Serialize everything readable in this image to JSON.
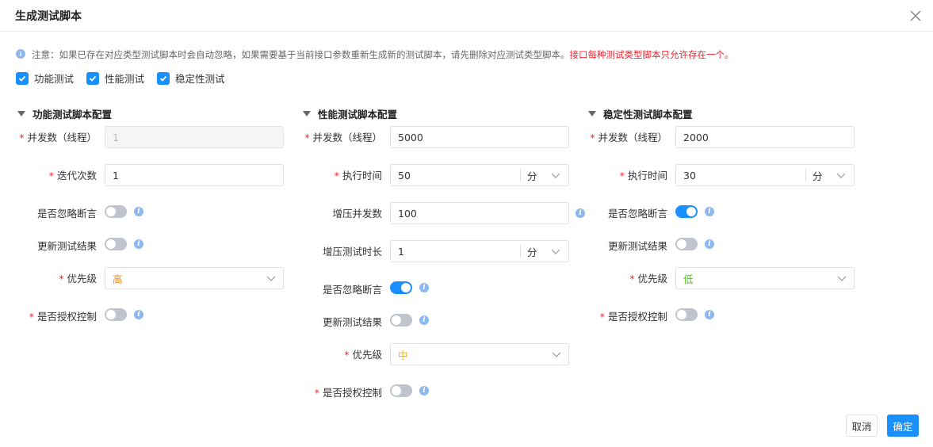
{
  "dialog": {
    "title": "生成测试脚本",
    "notice": "注意：如果已存在对应类型测试脚本时会自动忽略，如果需要基于当前接口参数重新生成新的测试脚本，请先删除对应测试类型脚本。",
    "notice_warning": "接口每种测试类型脚本只允许存在一个。",
    "checkboxes": [
      {
        "label": "功能测试",
        "checked": true
      },
      {
        "label": "性能测试",
        "checked": true
      },
      {
        "label": "稳定性测试",
        "checked": true
      }
    ],
    "cancel_label": "取消",
    "ok_label": "确定"
  },
  "func": {
    "title": "功能测试脚本配置",
    "concurrency_label": "并发数（线程）",
    "concurrency_value": "1",
    "iterations_label": "迭代次数",
    "iterations_value": "1",
    "ignore_assert_label": "是否忽略断言",
    "ignore_assert_on": false,
    "update_result_label": "更新测试结果",
    "update_result_on": false,
    "priority_label": "优先级",
    "priority_value": "高",
    "auth_label": "是否授权控制",
    "auth_on": false
  },
  "perf": {
    "title": "性能测试脚本配置",
    "concurrency_label": "并发数（线程）",
    "concurrency_value": "5000",
    "duration_label": "执行时间",
    "duration_value": "50",
    "duration_unit": "分",
    "ramp_label": "增压并发数",
    "ramp_value": "100",
    "ramp_time_label": "增压测试时长",
    "ramp_time_value": "1",
    "ramp_time_unit": "分",
    "ignore_assert_label": "是否忽略断言",
    "ignore_assert_on": true,
    "update_result_label": "更新测试结果",
    "update_result_on": false,
    "priority_label": "优先级",
    "priority_value": "中",
    "auth_label": "是否授权控制",
    "auth_on": false
  },
  "stab": {
    "title": "稳定性测试脚本配置",
    "concurrency_label": "并发数（线程）",
    "concurrency_value": "2000",
    "duration_label": "执行时间",
    "duration_value": "30",
    "duration_unit": "分",
    "ignore_assert_label": "是否忽略断言",
    "ignore_assert_on": true,
    "update_result_label": "更新测试结果",
    "update_result_on": false,
    "priority_label": "优先级",
    "priority_value": "低",
    "auth_label": "是否授权控制",
    "auth_on": false
  },
  "colors": {
    "accent": "#1890ff",
    "required": "#f5222d",
    "priority_high": "#fa8c16",
    "priority_mid": "#faad14",
    "priority_low": "#52c41a"
  }
}
